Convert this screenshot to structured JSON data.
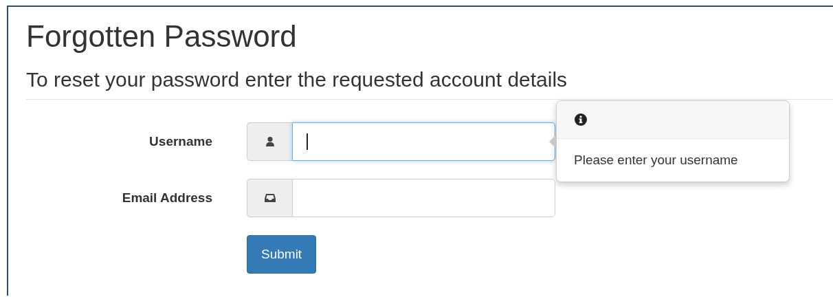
{
  "title": "Forgotten Password",
  "subtitle": "To reset your password enter the requested account details",
  "fields": [
    {
      "label": "Username",
      "kind": "user",
      "focused": true,
      "popover": {
        "text": "Please enter your username"
      }
    },
    {
      "label": "Email Address",
      "kind": "inbox",
      "focused": false
    }
  ],
  "submit": "Submit"
}
